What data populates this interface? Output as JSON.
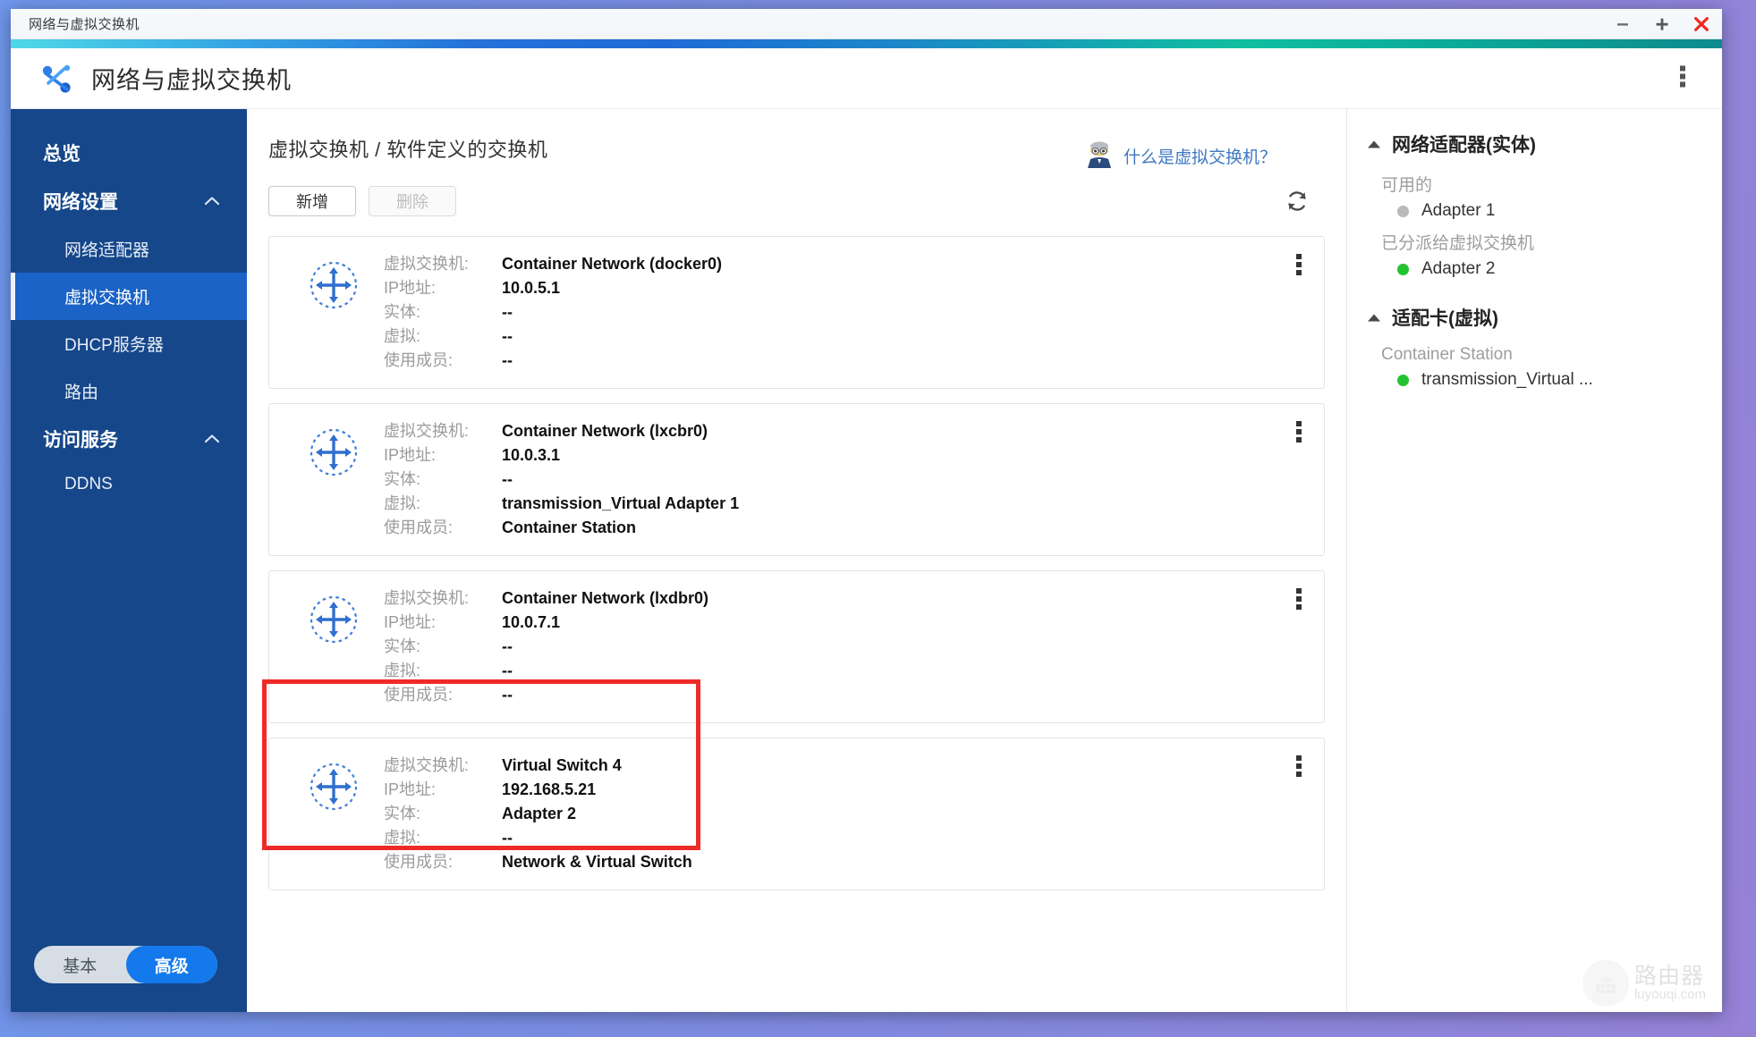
{
  "window": {
    "title": "网络与虚拟交换机",
    "controls": {
      "minimize": "minimize-icon",
      "maximize": "maximize-icon",
      "close": "close-icon"
    }
  },
  "app_header": {
    "title": "网络与虚拟交换机",
    "logo": "network-switch-logo",
    "menu_icon": "kebab-menu-icon"
  },
  "sidebar": {
    "items": [
      {
        "label": "总览",
        "type": "group",
        "expandable": false
      },
      {
        "label": "网络设置",
        "type": "group",
        "expandable": true,
        "expanded": true
      },
      {
        "label": "网络适配器",
        "type": "item",
        "active": false
      },
      {
        "label": "虚拟交换机",
        "type": "item",
        "active": true
      },
      {
        "label": "DHCP服务器",
        "type": "item",
        "active": false
      },
      {
        "label": "路由",
        "type": "item",
        "active": false
      },
      {
        "label": "访问服务",
        "type": "group",
        "expandable": true,
        "expanded": true
      },
      {
        "label": "DDNS",
        "type": "item",
        "active": false
      }
    ],
    "mode_toggle": {
      "basic": "基本",
      "advanced": "高级",
      "selected": "高级"
    }
  },
  "main": {
    "breadcrumb": {
      "parent": "虚拟交换机",
      "separator": "/",
      "current": "软件定义的交换机"
    },
    "toolbar": {
      "add_label": "新增",
      "delete_label": "删除",
      "delete_disabled": true,
      "refresh_icon": "refresh-icon"
    },
    "help": {
      "text": "什么是虚拟交换机？",
      "icon": "professor-avatar-icon"
    },
    "field_labels": {
      "switch": "虚拟交换机:",
      "ip": "IP地址:",
      "physical": "实体:",
      "virtual": "虚拟:",
      "used_by": "使用成员:"
    },
    "cards": [
      {
        "icon": "virtual-switch-icon",
        "switch": "Container Network (docker0)",
        "ip": "10.0.5.1",
        "physical": "--",
        "virtual": "--",
        "used_by": "--",
        "highlighted": false
      },
      {
        "icon": "virtual-switch-icon",
        "switch": "Container Network (lxcbr0)",
        "ip": "10.0.3.1",
        "physical": "--",
        "virtual": "transmission_Virtual Adapter 1",
        "used_by": "Container Station",
        "highlighted": false
      },
      {
        "icon": "virtual-switch-icon",
        "switch": "Container Network (lxdbr0)",
        "ip": "10.0.7.1",
        "physical": "--",
        "virtual": "--",
        "used_by": "--",
        "highlighted": false
      },
      {
        "icon": "virtual-switch-icon",
        "switch": "Virtual Switch 4",
        "ip": "192.168.5.21",
        "physical": "Adapter 2",
        "virtual": "--",
        "used_by": "Network & Virtual Switch",
        "highlighted": true
      }
    ],
    "annotation": {
      "highlight_color": "#ee2b28",
      "arrow_color": "#ee2b28",
      "arrow_direction": "left"
    }
  },
  "right_panel": {
    "sections": [
      {
        "title": "网络适配器(实体)",
        "collapse_icon": "triangle-up-icon",
        "groups": [
          {
            "label": "可用的",
            "rows": [
              {
                "label": "Adapter 1",
                "status_color": "#b9b9b9"
              }
            ]
          },
          {
            "label": "已分派给虚拟交换机",
            "rows": [
              {
                "label": "Adapter 2",
                "status_color": "#22c32e"
              }
            ]
          }
        ]
      },
      {
        "title": "适配卡(虚拟)",
        "collapse_icon": "triangle-up-icon",
        "groups": [
          {
            "label": "Container Station",
            "rows": [
              {
                "label": "transmission_Virtual ...",
                "status_color": "#22c32e"
              }
            ]
          }
        ]
      }
    ]
  },
  "watermark": {
    "cn": "路由器",
    "en": "luyouqi.com",
    "icon": "router-icon"
  },
  "colors": {
    "sidebar_bg": "#16478a",
    "sidebar_active": "#1b63c6",
    "accent_blue": "#1479ec",
    "link_blue": "#3f78c2",
    "status_green": "#22c32e",
    "status_gray": "#b9b9b9",
    "annotation_red": "#ee2b28"
  }
}
